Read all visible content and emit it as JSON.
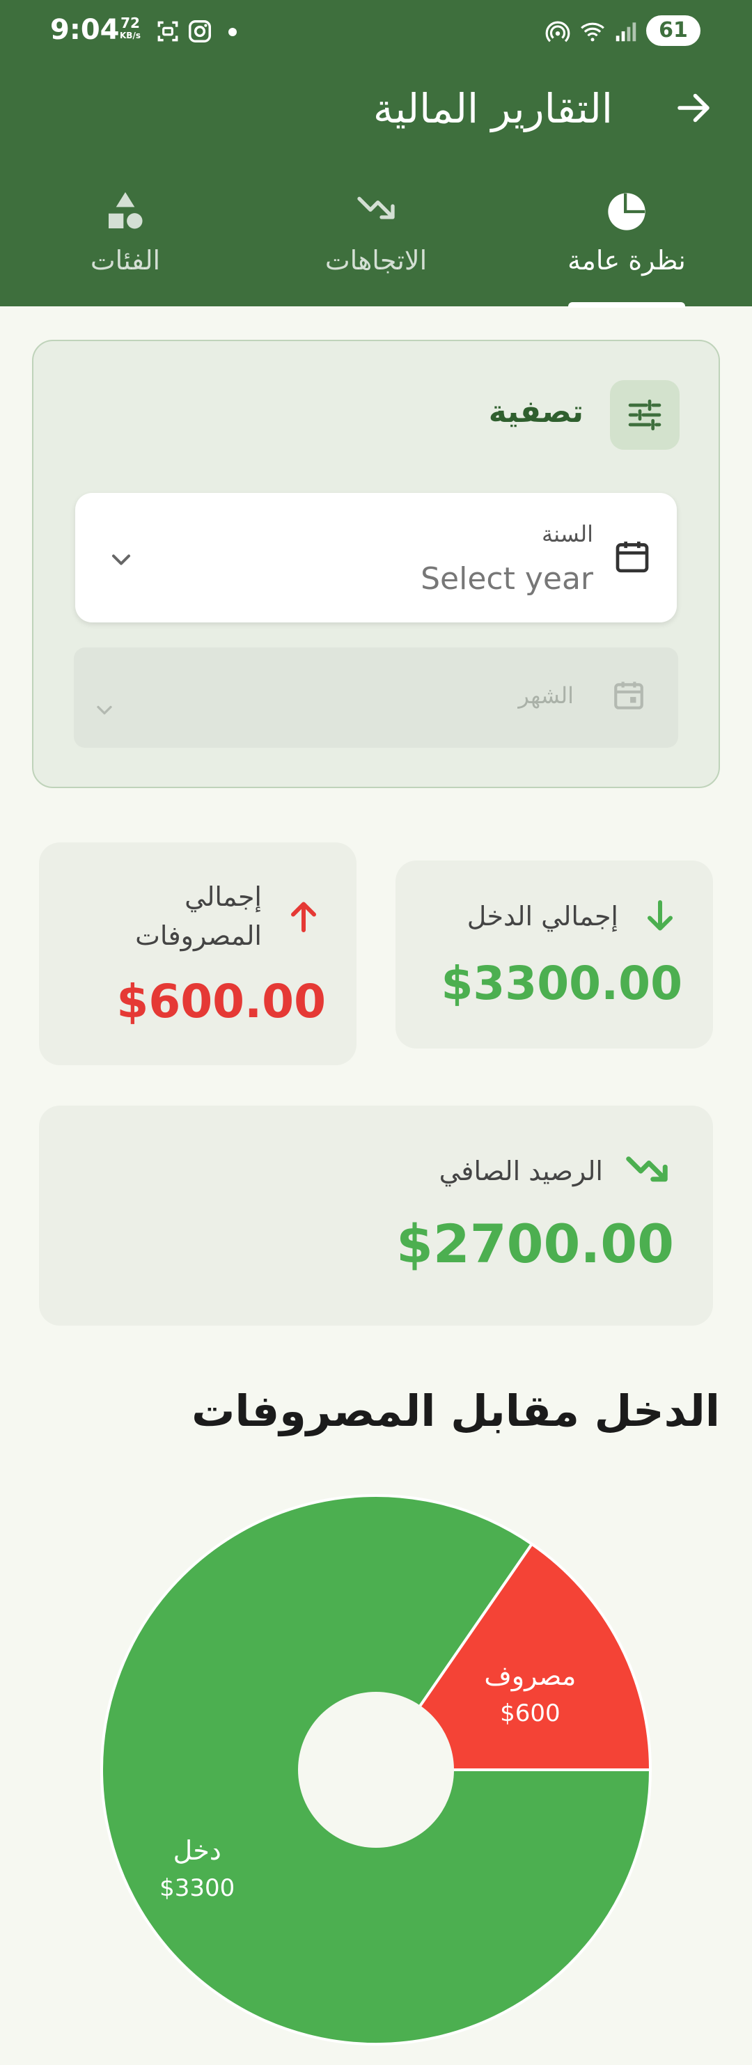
{
  "status_bar": {
    "time": "9:04",
    "speed_value": "72",
    "speed_unit": "KB/s",
    "battery": "61"
  },
  "header": {
    "title": "التقارير المالية",
    "back_icon": "arrow-right-icon"
  },
  "tabs": [
    {
      "label": "نظرة عامة",
      "icon": "pie-chart-icon",
      "active": true
    },
    {
      "label": "الاتجاهات",
      "icon": "trending-icon",
      "active": false
    },
    {
      "label": "الفئات",
      "icon": "shapes-icon",
      "active": false
    }
  ],
  "filter": {
    "title": "تصفية",
    "year_label": "السنة",
    "year_placeholder": "Select year",
    "month_label": "الشهر"
  },
  "summary": {
    "income_label": "إجمالي الدخل",
    "income_value": "$3300.00",
    "expense_label": "إجمالي المصروفات",
    "expense_value": "$600.00",
    "net_label": "الرصيد الصافي",
    "net_value": "$2700.00"
  },
  "colors": {
    "primary": "#3e6f3d",
    "income": "#4caf50",
    "expense": "#f44336",
    "background": "#f6f8f1"
  },
  "chart_title": "الدخل مقابل المصروفات",
  "chart_data": {
    "type": "pie",
    "title": "الدخل مقابل المصروفات",
    "labels": [
      "دخل",
      "مصروف"
    ],
    "values": [
      3300,
      600
    ],
    "value_labels": [
      "$3300",
      "$600"
    ],
    "colors": [
      "#4caf50",
      "#f44336"
    ],
    "donut": true
  }
}
